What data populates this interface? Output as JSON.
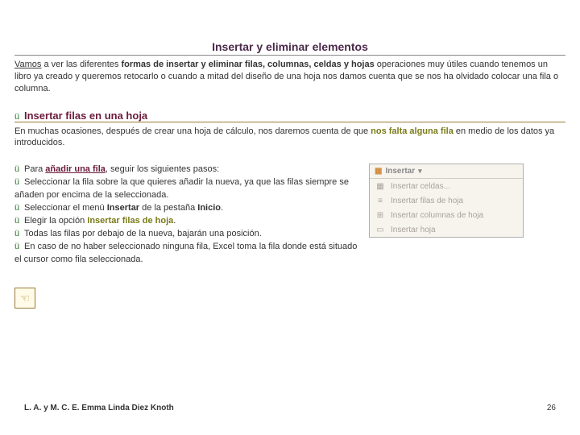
{
  "title": "Insertar y eliminar elementos",
  "intro": {
    "pre": "Vamos",
    "mid1": " a ver las diferentes ",
    "bold": "formas de insertar y eliminar filas, columnas, celdas y hojas",
    "mid2": " operaciones muy útiles cuando tenemos un libro ya creado y queremos retocarlo o cuando a mitad del diseño de una hoja nos damos cuenta que se nos ha olvidado colocar una fila o columna."
  },
  "subhead": "Insertar filas en una hoja",
  "para": {
    "t1": "En muchas ocasiones, después de crear una hoja de cálculo, nos daremos cuenta de que ",
    "olive": "nos falta alguna fila",
    "t2": " en medio de los datos ya introducidos."
  },
  "steps": [
    {
      "pre": "Para ",
      "hl": "añadir una fila",
      "post": ", seguir los siguientes pasos:",
      "hlClass": "maroon"
    },
    {
      "text": "Seleccionar la fila sobre la que quieres añadir la nueva, ya que las filas siempre se añaden por encima de la seleccionada."
    },
    {
      "pre": "Seleccionar el menú ",
      "b1": "Insertar",
      "mid": " de la pestaña ",
      "b2": "Inicio",
      "post": "."
    },
    {
      "pre": "Elegir la opción ",
      "hl": "Insertar filas de hoja",
      "post": ".",
      "hlClass": "olive"
    },
    {
      "text": "Todas las filas por debajo de la nueva, bajarán una posición."
    },
    {
      "text": "En caso de no haber seleccionado ninguna fila, Excel toma la fila donde está situado el cursor como fila seleccionada."
    }
  ],
  "menu": {
    "header": "Insertar",
    "items": [
      "Insertar celdas...",
      "Insertar filas de hoja",
      "Insertar columnas de hoja",
      "Insertar hoja"
    ]
  },
  "checkGlyph": "ü",
  "footer": {
    "author": "L. A. y M. C. E. Emma Linda Diez Knoth",
    "page": "26"
  }
}
